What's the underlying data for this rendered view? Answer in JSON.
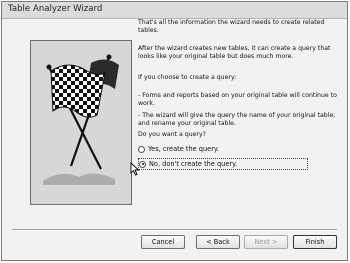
{
  "window": {
    "title": "Table Analyzer Wizard"
  },
  "content": {
    "intro": "That's all the information the wizard needs to create related tables.",
    "after_create": "After the wizard creates new tables, it can create a query that looks like your original table but does much more.",
    "if_choose": "If you choose to create a query:",
    "bullet_forms": "- Forms and reports based on your original table will continue to work.",
    "bullet_name": "- The wizard will give the query the name of your original table, and rename your original table.",
    "question": "Do you want a query?",
    "options": [
      {
        "label": "Yes, create the query.",
        "checked": false
      },
      {
        "label": "No, don't create the query.",
        "checked": true
      }
    ]
  },
  "buttons": {
    "cancel": "Cancel",
    "back": "< Back",
    "next": "Next >",
    "finish": "Finish"
  },
  "icons": {
    "illustration": "checkered-flag-icon",
    "pointer": "mouse-pointer-icon"
  }
}
